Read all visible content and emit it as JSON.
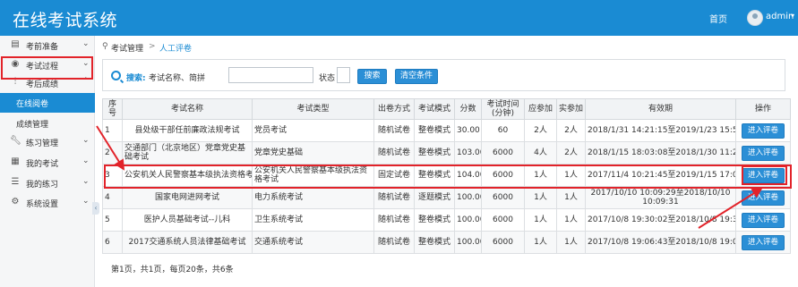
{
  "header": {
    "title": "在线考试系统",
    "home": "首页",
    "user": "admin",
    "user_caret": "▾"
  },
  "sidebar": {
    "items": [
      {
        "label": "考前准备",
        "icon": "document-icon",
        "chevron": "⌄"
      },
      {
        "label": "考试过程",
        "icon": "eye-icon",
        "chevron": "⌄"
      },
      {
        "label": "考后成绩",
        "icon": "sliders-icon",
        "chevron": "⌃"
      },
      {
        "label": "在线阅卷",
        "icon": "",
        "chevron": ""
      },
      {
        "label": "成绩管理",
        "icon": "",
        "chevron": ""
      },
      {
        "label": "练习管理",
        "icon": "wrench-icon",
        "chevron": "⌄"
      },
      {
        "label": "我的考试",
        "icon": "clipboard-icon",
        "chevron": "⌄"
      },
      {
        "label": "我的练习",
        "icon": "list-icon",
        "chevron": "⌄"
      },
      {
        "label": "系统设置",
        "icon": "gear-icon",
        "chevron": "⌄"
      }
    ]
  },
  "breadcrumb": {
    "root": "考试管理",
    "sep": ">",
    "current": "人工评卷"
  },
  "filter": {
    "search_label": "搜索:",
    "name_label": "考试名称、简拼",
    "name_value": "",
    "status_label": "状态",
    "status_value": "",
    "search_button": "搜索",
    "clear_button": "清空条件"
  },
  "table": {
    "columns": [
      "序号",
      "考试名称",
      "考试类型",
      "出卷方式",
      "考试模式",
      "分数",
      "考试时间(分钟)",
      "应参加",
      "实参加",
      "有效期",
      "操作"
    ],
    "rows": [
      [
        "1",
        "县处级干部任前廉政法规考试",
        "党员考试",
        "随机试卷",
        "整卷模式",
        "30.00",
        "60",
        "2人",
        "2人",
        "2018/1/31 14:21:15至2019/1/23 15:55:10",
        "进入评卷"
      ],
      [
        "2",
        "交通部门（北京地区）党章党史基础考试",
        "党章党史基础",
        "随机试卷",
        "整卷模式",
        "103.00",
        "6000",
        "4人",
        "2人",
        "2018/1/15 18:03:08至2018/1/30 11:24:38",
        "进入评卷"
      ],
      [
        "3",
        "公安机关人民警察基本级执法资格考试",
        "公安机关人民警察基本级执法资格考试",
        "固定试卷",
        "整卷模式",
        "104.00",
        "6000",
        "1人",
        "1人",
        "2017/11/4 10:21:45至2019/1/15 17:09:58",
        "进入评卷"
      ],
      [
        "4",
        "国家电网进网考试",
        "电力系统考试",
        "随机试卷",
        "逐题模式",
        "100.00",
        "6000",
        "1人",
        "1人",
        "2017/10/10 10:09:29至2018/10/10 10:09:31",
        "进入评卷"
      ],
      [
        "5",
        "医护人员基础考试--儿科",
        "卫生系统考试",
        "随机试卷",
        "整卷模式",
        "100.00",
        "6000",
        "1人",
        "1人",
        "2017/10/8 19:30:02至2018/10/8 19:30:04",
        "进入评卷"
      ],
      [
        "6",
        "2017交通系统人员法律基础考试",
        "交通系统考试",
        "随机试卷",
        "整卷模式",
        "100.00",
        "6000",
        "1人",
        "1人",
        "2017/10/8 19:06:43至2018/10/8 19:06:45",
        "进入评卷"
      ]
    ]
  },
  "pagination": {
    "text": "第1页，共1页，每页20条，共6条"
  },
  "colors": {
    "brand": "#1a8bd3",
    "highlight": "#e2232a"
  }
}
